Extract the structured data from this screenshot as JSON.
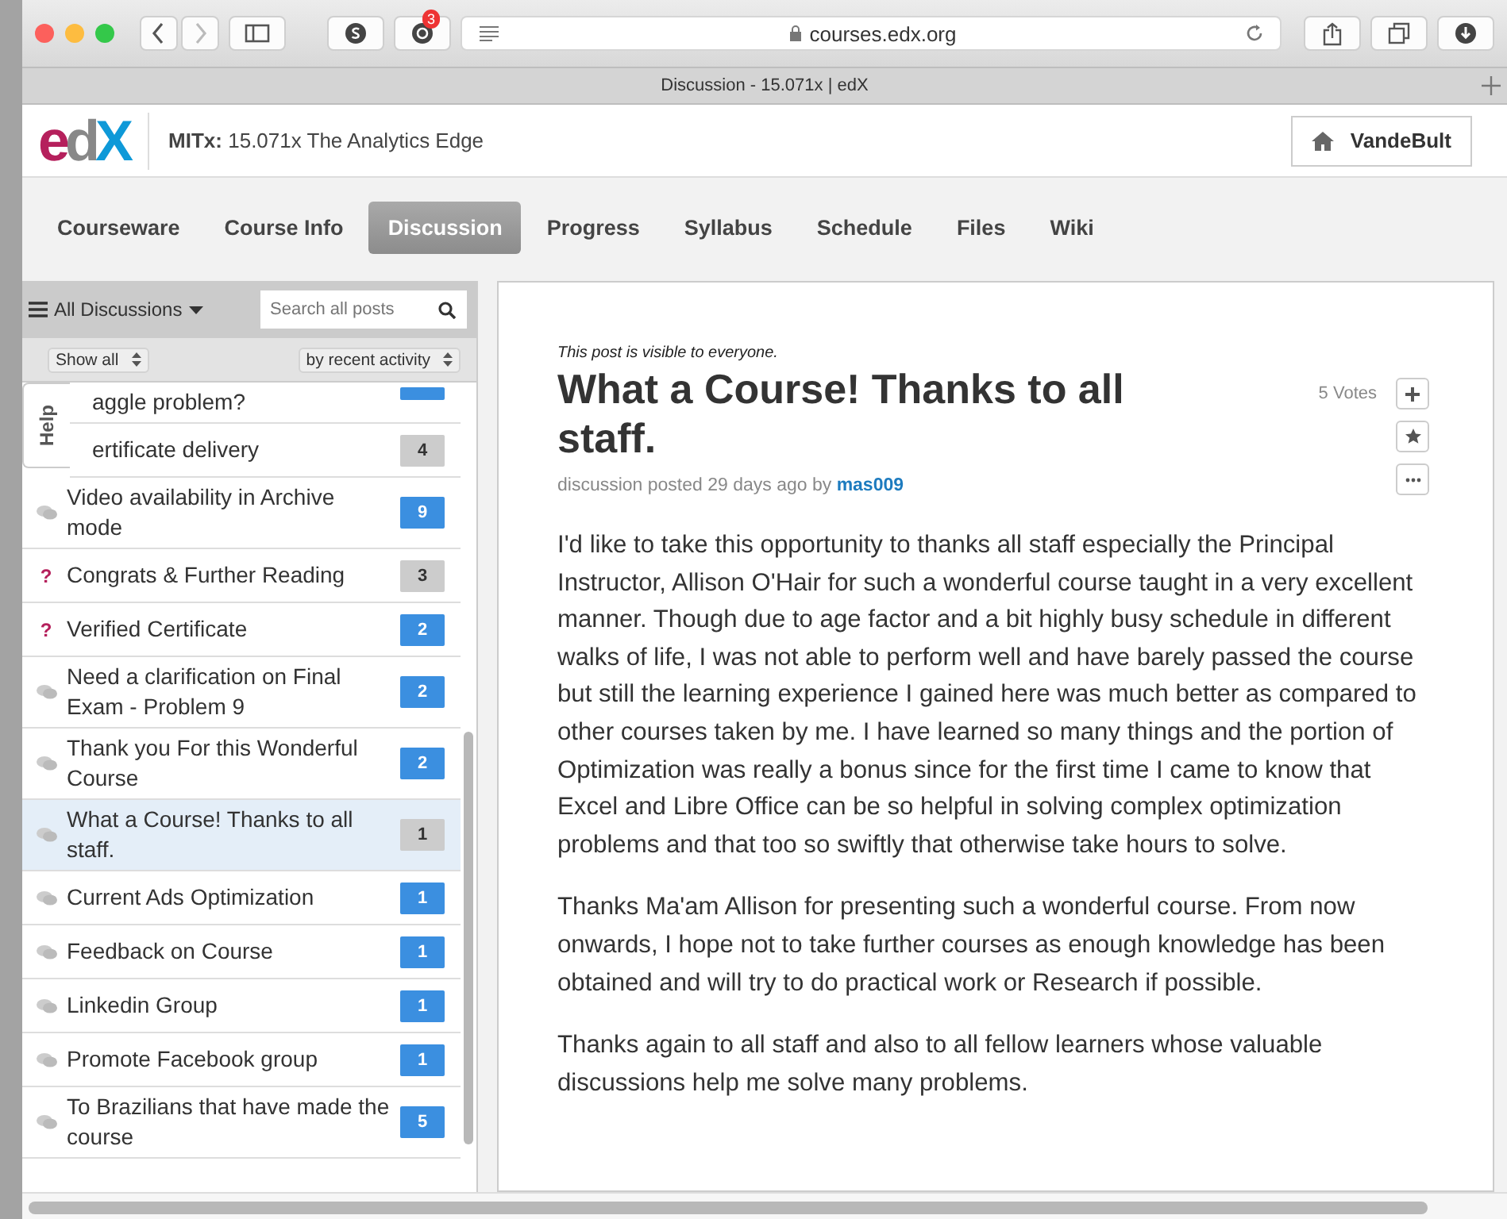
{
  "browser": {
    "url": "courses.edx.org",
    "tab_title": "Discussion - 15.071x | edX",
    "extension_badge": "3"
  },
  "header": {
    "logo": "edX",
    "org": "MITx:",
    "course": "15.071x The Analytics Edge",
    "user": "VandeBult"
  },
  "nav": [
    {
      "label": "Courseware",
      "selected": false
    },
    {
      "label": "Course Info",
      "selected": false
    },
    {
      "label": "Discussion",
      "selected": true
    },
    {
      "label": "Progress",
      "selected": false
    },
    {
      "label": "Syllabus",
      "selected": false
    },
    {
      "label": "Schedule",
      "selected": false
    },
    {
      "label": "Files",
      "selected": false
    },
    {
      "label": "Wiki",
      "selected": false
    }
  ],
  "sidebar": {
    "filter": "All Discussions",
    "search": {
      "placeholder": "Search all posts"
    },
    "show": "Show all",
    "sort": "by recent activity",
    "help": "Help",
    "posts": [
      {
        "title": "aggle problem?",
        "kind": "cut",
        "unread": true,
        "selected": false
      },
      {
        "title": "ertificate delivery",
        "kind": "cut",
        "count": "4",
        "unread": false,
        "selected": false
      },
      {
        "title": "Video availability in Archive mode",
        "kind": "discussion",
        "count": "9",
        "unread": true,
        "selected": false
      },
      {
        "title": "Congrats & Further Reading",
        "kind": "question",
        "marker": "?",
        "count": "3",
        "unread": false,
        "selected": false
      },
      {
        "title": "Verified Certificate",
        "kind": "question",
        "marker": "?",
        "count": "2",
        "unread": true,
        "selected": false
      },
      {
        "title": "Need a clarification on Final Exam - Problem 9",
        "kind": "discussion",
        "count": "2",
        "unread": true,
        "selected": false
      },
      {
        "title": "Thank you For this Wonderful Course",
        "kind": "discussion",
        "count": "2",
        "unread": true,
        "selected": false
      },
      {
        "title": "What a Course! Thanks to all staff.",
        "kind": "discussion",
        "count": "1",
        "unread": false,
        "selected": true
      },
      {
        "title": "Current Ads Optimization",
        "kind": "discussion",
        "count": "1",
        "unread": true,
        "selected": false
      },
      {
        "title": "Feedback on Course",
        "kind": "discussion",
        "count": "1",
        "unread": true,
        "selected": false
      },
      {
        "title": "Linkedin Group",
        "kind": "discussion",
        "count": "1",
        "unread": true,
        "selected": false
      },
      {
        "title": "Promote Facebook group",
        "kind": "discussion",
        "count": "1",
        "unread": true,
        "selected": false
      },
      {
        "title": "To Brazilians that have made the course",
        "kind": "discussion",
        "count": "5",
        "unread": true,
        "selected": false
      }
    ]
  },
  "post": {
    "visibility": "This post is visible to everyone.",
    "title": "What a Course! Thanks to all staff.",
    "votes": "5 Votes",
    "meta": "discussion posted 29 days ago by",
    "author": "mas009",
    "paragraphs": [
      "I'd like to take this opportunity to thanks all staff especially the Principal Instructor, Allison O'Hair for such a wonderful course taught in a very excellent manner. Though due to age factor and a bit highly busy schedule in different walks of life, I was not able to perform well and have barely passed the course but still the learning experience I gained here was much better as compared to other courses taken by me. I have learned so many things and the portion of Optimization was really a bonus since for the first time I came to know that Excel and Libre Office can be so helpful in solving complex optimization problems and that too so swiftly that otherwise take hours to solve.",
      "Thanks Ma'am Allison for presenting such a wonderful course. From now onwards, I hope not to take further courses as enough knowledge has been obtained and will try to do practical work or Research if possible.",
      "Thanks again to all staff and also to all fellow learners whose valuable discussions help me solve many problems."
    ]
  }
}
